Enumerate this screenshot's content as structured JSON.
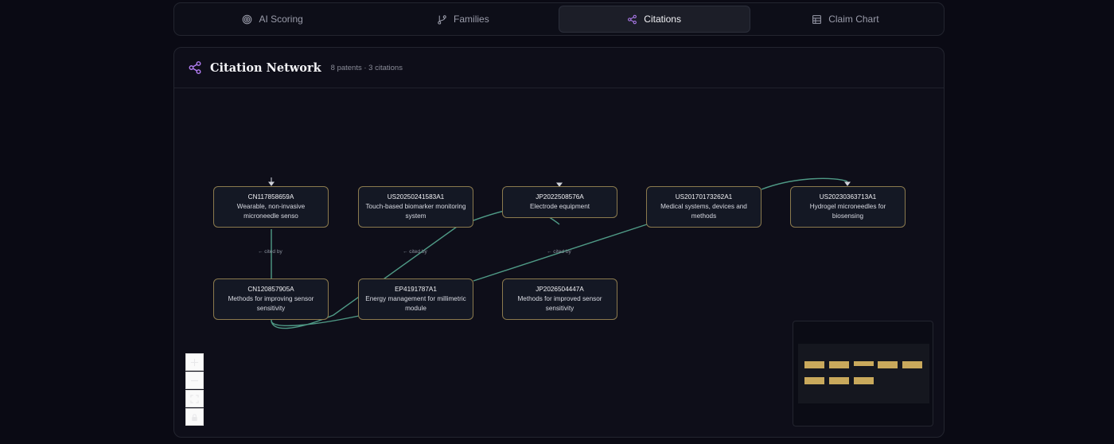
{
  "tabs": [
    {
      "label": "AI Scoring",
      "icon": "target-icon",
      "active": false
    },
    {
      "label": "Families",
      "icon": "git-branch-icon",
      "active": false
    },
    {
      "label": "Citations",
      "icon": "share-icon",
      "active": true
    },
    {
      "label": "Claim Chart",
      "icon": "table-icon",
      "active": false
    }
  ],
  "panel": {
    "icon": "share-icon",
    "title": "Citation Network",
    "meta": "8 patents · 3 citations"
  },
  "nodes": [
    {
      "id": "CN117858659A",
      "label": "Wearable, non-invasive microneedle senso"
    },
    {
      "id": "US20250241583A1",
      "label": "Touch-based biomarker monitoring system"
    },
    {
      "id": "JP2022508576A",
      "label": "Electrode equipment"
    },
    {
      "id": "US20170173262A1",
      "label": "Medical systems, devices and methods"
    },
    {
      "id": "US20230363713A1",
      "label": "Hydrogel microneedles for biosensing"
    },
    {
      "id": "CN120857905A",
      "label": "Methods for improving sensor sensitivity"
    },
    {
      "id": "EP4191787A1",
      "label": "Energy management for millimetric module"
    },
    {
      "id": "JP2026504447A",
      "label": "Methods for improved sensor sensitivity"
    }
  ],
  "edge_labels": [
    "← cited by",
    "← cited by",
    "← cited by"
  ],
  "colors": {
    "edge": "#4f9a86",
    "node_border": "#8b7a4e",
    "accent": "#b07cf0",
    "minimap_node": "#c9a95c"
  },
  "controls": [
    {
      "icon": "plus-icon"
    },
    {
      "icon": "minus-icon"
    },
    {
      "icon": "fit-view-icon"
    },
    {
      "icon": "lock-icon"
    }
  ]
}
